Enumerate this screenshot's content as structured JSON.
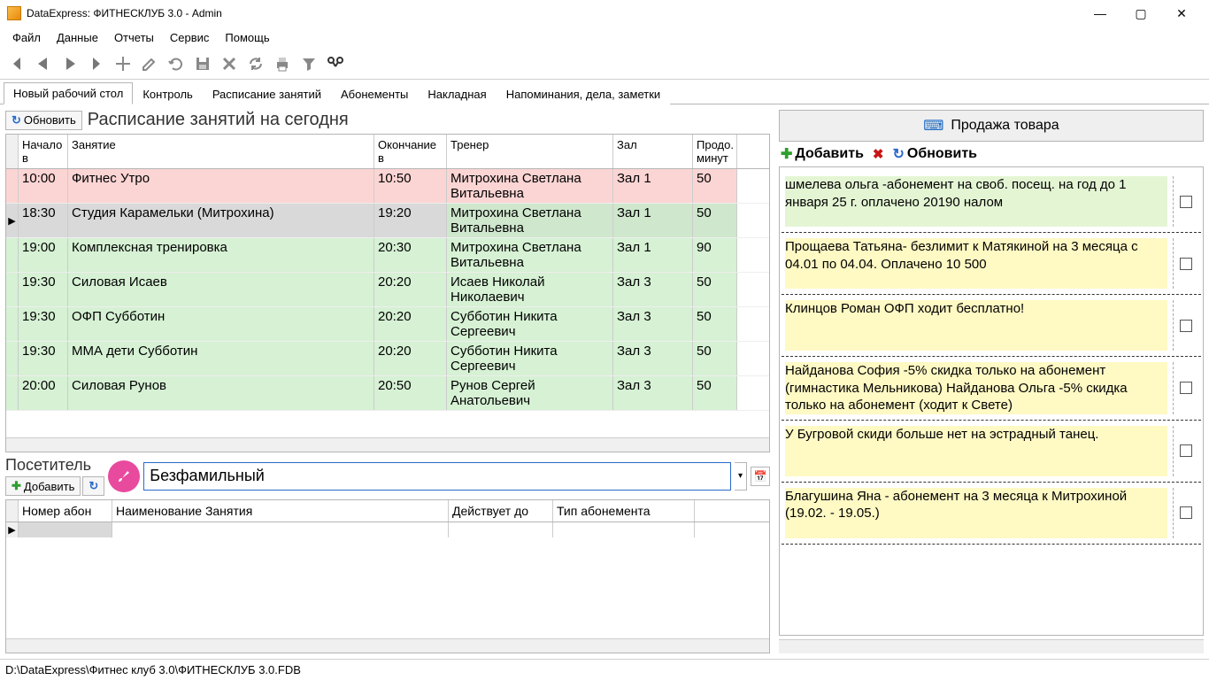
{
  "title": "DataExpress: ФИТНЕСКЛУБ 3.0 - Admin",
  "menu": [
    "Файл",
    "Данные",
    "Отчеты",
    "Сервис",
    "Помощь"
  ],
  "tabs": [
    "Новый рабочий стол",
    "Контроль",
    "Расписание занятий",
    "Абонементы",
    "Накладная",
    "Напоминания, дела, заметки"
  ],
  "refresh_label": "Обновить",
  "heading": "Расписание занятий на сегодня",
  "schedule_columns": [
    "",
    "Начало в",
    "Занятие",
    "Окончание в",
    "Тренер",
    "Зал",
    "Продо. минут"
  ],
  "schedule": [
    {
      "start": "10:00",
      "name": "Фитнес Утро",
      "end": "10:50",
      "trainer": "Митрохина Светлана Витальевна",
      "hall": "Зал 1",
      "dur": "50",
      "cls": "pink"
    },
    {
      "start": "18:30",
      "name": "Студия Карамельки (Митрохина)",
      "end": "19:20",
      "trainer": "Митрохина Светлана Витальевна",
      "hall": "Зал 1",
      "dur": "50",
      "cls": "sel"
    },
    {
      "start": "19:00",
      "name": "Комплексная тренировка",
      "end": "20:30",
      "trainer": "Митрохина Светлана Витальевна",
      "hall": "Зал 1",
      "dur": "90",
      "cls": "green"
    },
    {
      "start": "19:30",
      "name": "Силовая Исаев",
      "end": "20:20",
      "trainer": "Исаев Николай Николаевич",
      "hall": "Зал 3",
      "dur": "50",
      "cls": "green"
    },
    {
      "start": "19:30",
      "name": "ОФП Субботин",
      "end": "20:20",
      "trainer": "Субботин Никита Сергеевич",
      "hall": "Зал 3",
      "dur": "50",
      "cls": "green"
    },
    {
      "start": "19:30",
      "name": "ММА дети Субботин",
      "end": "20:20",
      "trainer": "Субботин Никита Сергеевич",
      "hall": "Зал 3",
      "dur": "50",
      "cls": "green"
    },
    {
      "start": "20:00",
      "name": "Силовая Рунов",
      "end": "20:50",
      "trainer": "Рунов Сергей Анатольевич",
      "hall": "Зал 3",
      "dur": "50",
      "cls": "green"
    }
  ],
  "visitor_label": "Посетитель",
  "add_label": "Добавить",
  "visitor_value": "Безфамильный",
  "abon_columns": [
    "Номер абон",
    "Наименование Занятия",
    "Действует до",
    "Тип абонемента"
  ],
  "sale_label": "Продажа товара",
  "notes_add": "Добавить",
  "notes_refresh": "Обновить",
  "notes": [
    {
      "txt": "шмелева ольга -абонемент на своб. посещ. на год до 1 января 25 г. оплачено 20190 налом",
      "cls": "hlg"
    },
    {
      "txt": "Прощаева Татьяна- безлимит к Матякиной на 3 месяца с 04.01 по 04.04. Оплачено 10 500",
      "cls": "hl"
    },
    {
      "txt": "Клинцов Роман ОФП ходит бесплатно!",
      "cls": "hl"
    },
    {
      "txt": "Найданова София -5% скидка только на абонемент (гимнастика Мельникова) Найданова Ольга -5% скидка только на абонемент (ходит к Свете)",
      "cls": "hl"
    },
    {
      "txt": " У Бугровой скиди больше нет на эстрадный танец.",
      "cls": "hl"
    },
    {
      "txt": "Благушина Яна - абонемент на 3 месяца к Митрохиной (19.02. - 19.05.)",
      "cls": "hl"
    }
  ],
  "status_path": "D:\\DataExpress\\Фитнес клуб 3.0\\ФИТНЕСКЛУБ 3.0.FDB"
}
